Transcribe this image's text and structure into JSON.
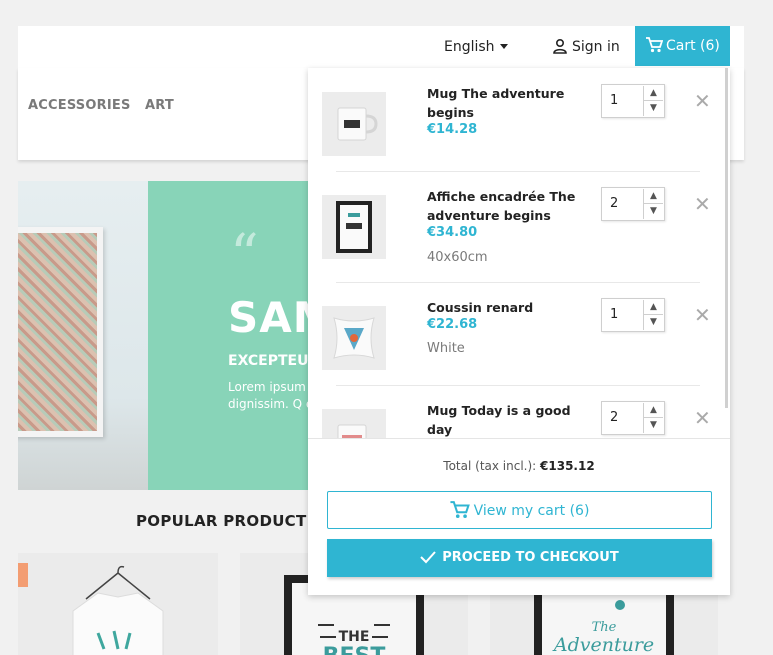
{
  "header": {
    "language": "English",
    "signin_label": "Sign in",
    "cart_label": "Cart (6)"
  },
  "nav": {
    "items": [
      "ACCESSORIES",
      "ART"
    ]
  },
  "hero": {
    "quote_mark": "“",
    "title": "SAM",
    "subtitle": "EXCEPTEU",
    "body": "Lorem ipsum adipiscing eli dignissim. Q egestas sem"
  },
  "popular_title": "POPULAR PRODUCT",
  "cart": {
    "items": [
      {
        "name": "Mug The adventure begins",
        "price": "€14.28",
        "attr": "",
        "qty": "1"
      },
      {
        "name": "Affiche encadrée The adventure begins",
        "price": "€34.80",
        "attr": "40x60cm",
        "qty": "2"
      },
      {
        "name": "Coussin renard",
        "price": "€22.68",
        "attr": "White",
        "qty": "1"
      },
      {
        "name": "Mug Today is a good day",
        "price": "",
        "attr": "",
        "qty": "2"
      }
    ],
    "total_label": "Total (tax incl.):",
    "total_value": "€135.12",
    "view_cart_label": "View my cart (6)",
    "checkout_label": "PROCEED TO CHECKOUT"
  },
  "colors": {
    "accent": "#2fb5d2",
    "hero_green": "#88d4b8",
    "price": "#2fb5d2"
  }
}
